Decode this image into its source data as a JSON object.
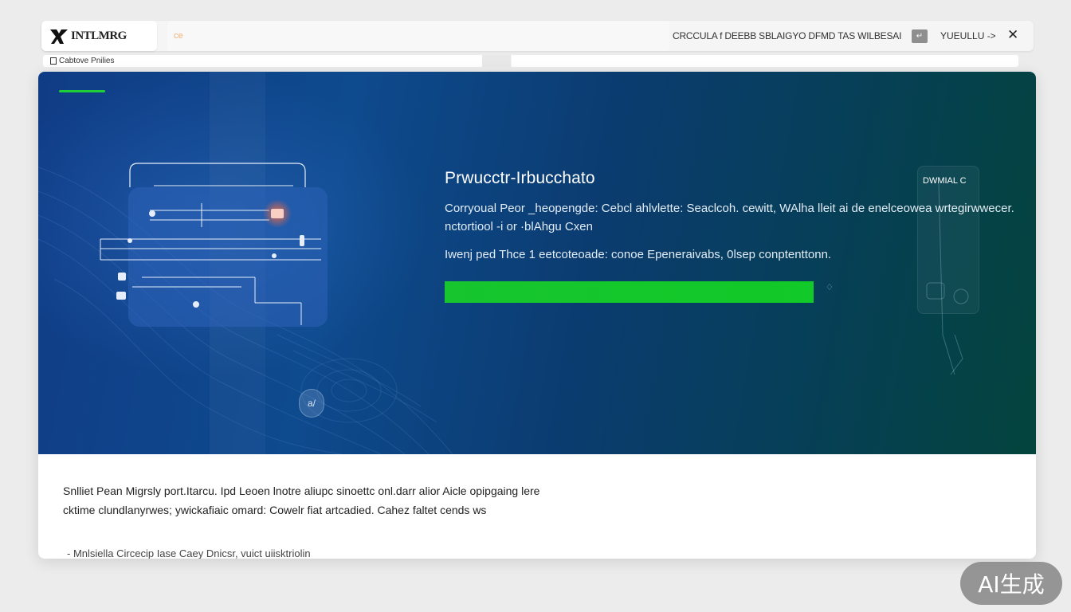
{
  "header": {
    "logo_text": "INTLMRG",
    "search_hint": "ce",
    "nav_text": "CRCCULA  f DEEBB SBLAIGYO DFMD TAS WILBESAI",
    "nav_badge": "↵",
    "nav_link": "YUEULLU ->",
    "close_label": "✕"
  },
  "breadcrumb": {
    "text": "Cabtove Pnilies"
  },
  "hero": {
    "title": "Prwucctr-Irbucchato",
    "description": "Corryoual Peor _heopengde: Cebcl ahlvlette: Seaclcoh. cewitt, WAlha lleit ai de enelceowea wrtegirwwecer. nctortiool -i or ·blAhgu Cxen",
    "note": "Iwenj ped Thce 1 eetcoteoade: conoe Epeneraivabs, 0lsep conptenttonn.",
    "progress": {
      "fraction": 1.0,
      "marker": "♢"
    },
    "side_label": "DWMIAL C",
    "floating_badge": "a/"
  },
  "body": {
    "paragraph": "Snlliet Pean Migrsly port.Itarcu. Ipd Leoen lnotre aliupc sinoettc onl.darr alior Aicle opipgaing lere cktime clundlanyrwes; ywickafiaic omard: Cowelr fiat artcadied. Cahez faltet cends ws",
    "bullet": "- Mnlsiella Circecip Iase Caey Dnicsr, vuict uiisktriolin"
  },
  "watermark": "AI生成",
  "colors": {
    "accent_green": "#11c928",
    "hero_start": "#103c86",
    "hero_end": "#03443d"
  },
  "icons": {
    "logo": "brand-logo-icon",
    "breadcrumb": "document-icon",
    "close": "close-icon"
  }
}
